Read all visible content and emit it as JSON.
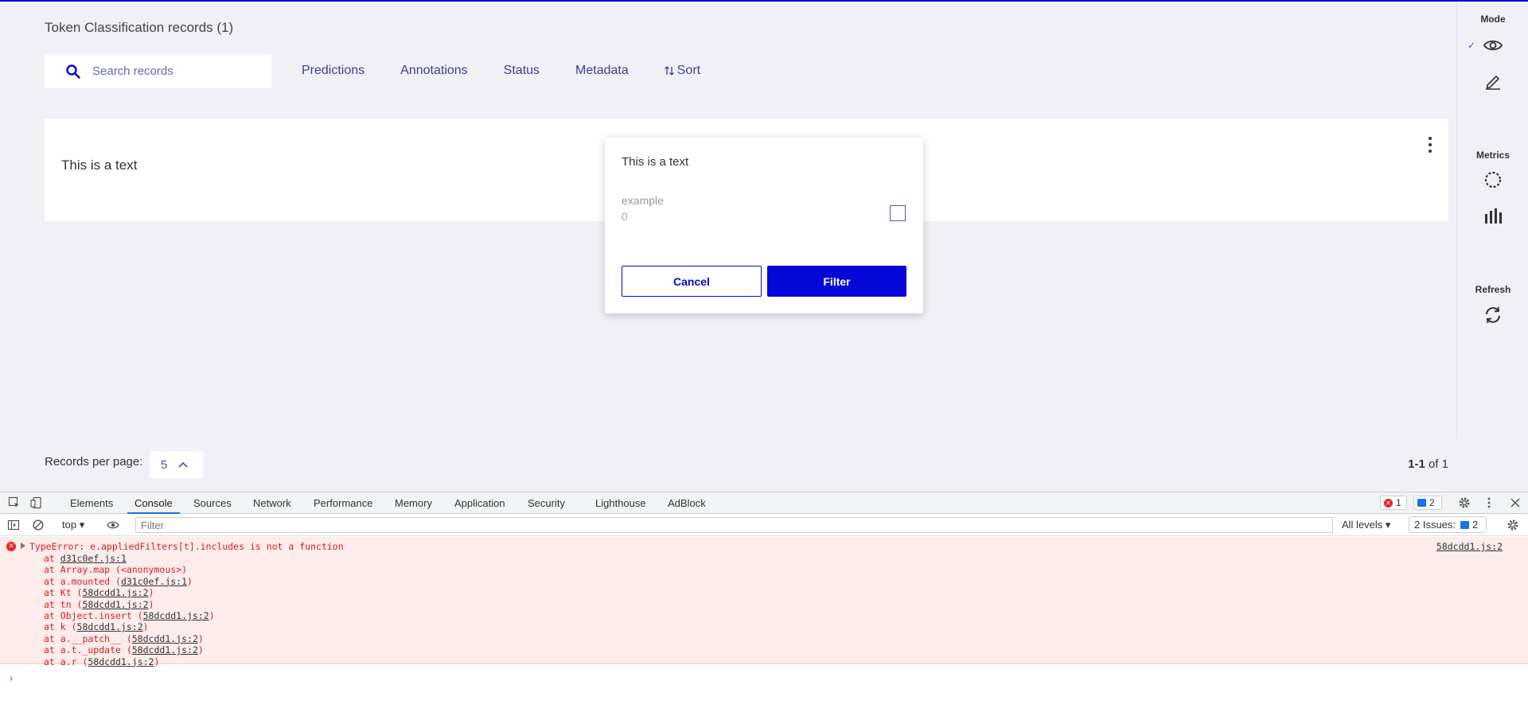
{
  "app": {
    "page_title": "Token Classification records (1)",
    "search_placeholder": "Search records",
    "filters": [
      "Predictions",
      "Annotations",
      "Status",
      "Metadata"
    ],
    "sort_label": "Sort",
    "record_text": "This is a text",
    "accent_color": "#0508d9"
  },
  "popup": {
    "title": "This is a text",
    "option_label": "example",
    "option_count": "0",
    "cancel_label": "Cancel",
    "filter_label": "Filter"
  },
  "sidebar": {
    "mode_label": "Mode",
    "metrics_label": "Metrics",
    "refresh_label": "Refresh",
    "icons": [
      "eye-icon",
      "pencil-icon",
      "progress-icon",
      "bar-chart-icon",
      "refresh-icon"
    ]
  },
  "pagination": {
    "rpp_label": "Records per page:",
    "rpp_value": "5",
    "range": "1-1",
    "of_label": "of 1"
  },
  "devtools": {
    "tabs": [
      "Elements",
      "Console",
      "Sources",
      "Network",
      "Performance",
      "Memory",
      "Application",
      "Security",
      "Lighthouse",
      "AdBlock"
    ],
    "active_tab": "Console",
    "error_count": "1",
    "message_count": "2",
    "context": "top",
    "filter_placeholder": "Filter",
    "levels": "All levels",
    "issues_label": "2 Issues:",
    "issues_count": "2",
    "error_message": "TypeError: e.appliedFilters[t].includes is not a function",
    "error_source": "58dcdd1.js:2",
    "stack": [
      {
        "prefix": "at ",
        "fn": "",
        "link": "d31c0ef.js:1"
      },
      {
        "prefix": "at Array.map (<anonymous>)",
        "fn": "",
        "link": ""
      },
      {
        "prefix": "at a.mounted (",
        "fn": "",
        "link": "d31c0ef.js:1"
      },
      {
        "prefix": "at Kt (",
        "fn": "",
        "link": "58dcdd1.js:2"
      },
      {
        "prefix": "at tn (",
        "fn": "",
        "link": "58dcdd1.js:2"
      },
      {
        "prefix": "at Object.insert (",
        "fn": "",
        "link": "58dcdd1.js:2"
      },
      {
        "prefix": "at k (",
        "fn": "",
        "link": "58dcdd1.js:2"
      },
      {
        "prefix": "at a.__patch__ (",
        "fn": "",
        "link": "58dcdd1.js:2"
      },
      {
        "prefix": "at a.t._update (",
        "fn": "",
        "link": "58dcdd1.js:2"
      },
      {
        "prefix": "at a.r (",
        "fn": "",
        "link": "58dcdd1.js:2"
      }
    ]
  }
}
